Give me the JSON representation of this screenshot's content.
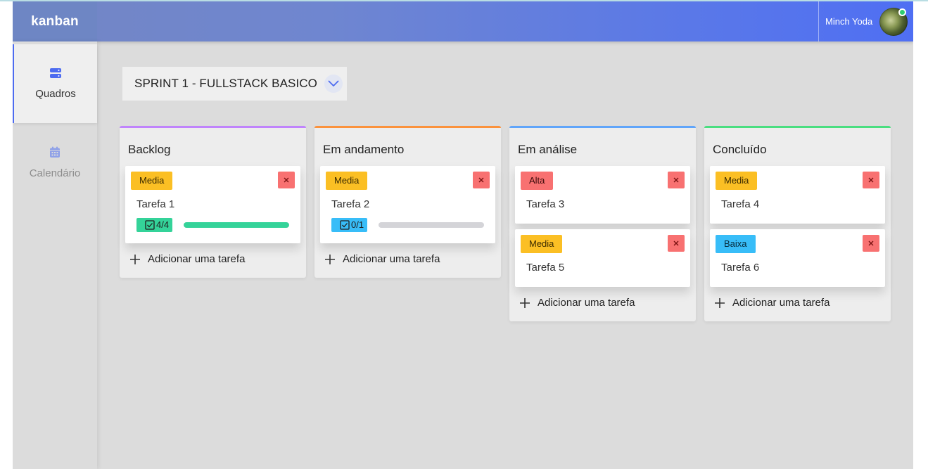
{
  "app": {
    "logo": "kanban"
  },
  "user": {
    "name": "Minch Yoda"
  },
  "sidebar": {
    "items": [
      {
        "label": "Quadros",
        "icon": "server-stack-icon"
      },
      {
        "label": "Calendário",
        "icon": "calendar-icon"
      }
    ]
  },
  "sprint": {
    "title": "SPRINT 1 - FULLSTACK BASICO"
  },
  "columns": [
    {
      "title": "Backlog",
      "accent": "#c084fc",
      "tasks": [
        {
          "priority": "Media",
          "title": "Tarefa 1",
          "checklist": "4/4",
          "progress": 1.0
        }
      ],
      "add_label": "Adicionar uma tarefa"
    },
    {
      "title": "Em andamento",
      "accent": "#fb923c",
      "tasks": [
        {
          "priority": "Media",
          "title": "Tarefa 2",
          "checklist": "0/1",
          "progress": 0.0
        }
      ],
      "add_label": "Adicionar uma tarefa"
    },
    {
      "title": "Em análise",
      "accent": "#60a5fa",
      "tasks": [
        {
          "priority": "Alta",
          "title": "Tarefa 3"
        },
        {
          "priority": "Media",
          "title": "Tarefa 5"
        }
      ],
      "add_label": "Adicionar uma tarefa"
    },
    {
      "title": "Concluído",
      "accent": "#4ade80",
      "tasks": [
        {
          "priority": "Media",
          "title": "Tarefa 4"
        },
        {
          "priority": "Baixa",
          "title": "Tarefa 6"
        }
      ],
      "add_label": "Adicionar uma tarefa"
    }
  ],
  "colors": {
    "header_gradient_start": "#7386c4",
    "header_gradient_end": "#4f6ff3",
    "priority_media": "#fbbf24",
    "priority_alta": "#f87171",
    "priority_baixa": "#38bdf8",
    "delete_button": "#f87171",
    "progress_fill": "#34d399"
  }
}
